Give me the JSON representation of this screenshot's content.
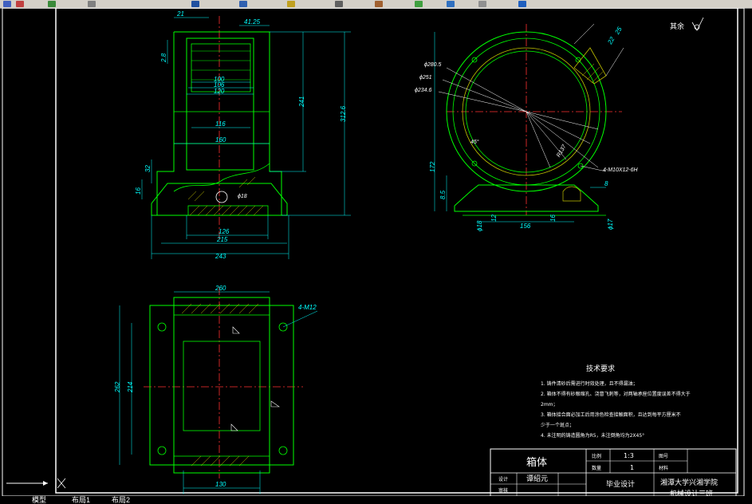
{
  "toolbar": {
    "icons": [
      "undo-icon",
      "redo-icon",
      "zoom-icon",
      "pan-icon",
      "print-icon",
      "save-icon",
      "open-icon",
      "copy-icon",
      "paste-icon",
      "match-icon",
      "properties-icon",
      "layer-icon",
      "help-icon"
    ]
  },
  "tabs": {
    "model": "模型",
    "layout1": "布局1",
    "layout2": "布局2"
  },
  "surface_mark": "其余",
  "front_view": {
    "dims": {
      "d21": "21",
      "d4125": "41.25",
      "d28": "2.8",
      "d100": "100",
      "d106": "106",
      "d120": "120",
      "d116": "116",
      "d160": "160",
      "d241": "241",
      "d3126": "312.6",
      "d32": "32",
      "d16": "16",
      "phi18": "ϕ18",
      "d126": "126",
      "d215": "215",
      "d243": "243"
    }
  },
  "side_view": {
    "dims": {
      "phi2805": "ϕ280.5",
      "phi251": "ϕ251",
      "phi2346": "ϕ234.6",
      "deg45": "45°",
      "r137": "R137",
      "m10": "4-M10X12-6H",
      "d172": "172",
      "d85": "8.5",
      "d12": "12",
      "phi18": "ϕ18",
      "d156": "156",
      "d16": "16",
      "phi17": "ϕ17",
      "d8": "8",
      "d22": "22",
      "d25": "25"
    }
  },
  "top_view": {
    "dims": {
      "d260": "260",
      "m12": "4-M12",
      "d262": "262",
      "d214": "214",
      "d130": "130"
    }
  },
  "tech_req": {
    "title": "技术要求",
    "items": [
      "1. 铸件清砂后需进行时效处理，且不得漏油；",
      "2. 箱体不得有砂眼缩孔、浇冒飞刺等，对两轴承座位置度误差不得大于",
      "   2mm；",
      "3. 箱体接合面必加工后用涂色检查接触面积，且达到每平方厘米不",
      "   少于一个斑点；",
      "4. 未注明的铸造圆角为R5，未注倒角均为2X45°"
    ]
  },
  "title_block": {
    "part_name": "箱体",
    "scale_label": "比例",
    "scale_value": "1:3",
    "qty_label": "数量",
    "qty_value": "1",
    "drawing_no_label": "图号",
    "material_label": "材料",
    "designer_label": "设计",
    "designer_name": "谭绍元",
    "reviewer_label": "审核",
    "project": "毕业设计",
    "school_line1": "湘潭大学兴湘学院",
    "school_line2": "机械设计三班"
  }
}
